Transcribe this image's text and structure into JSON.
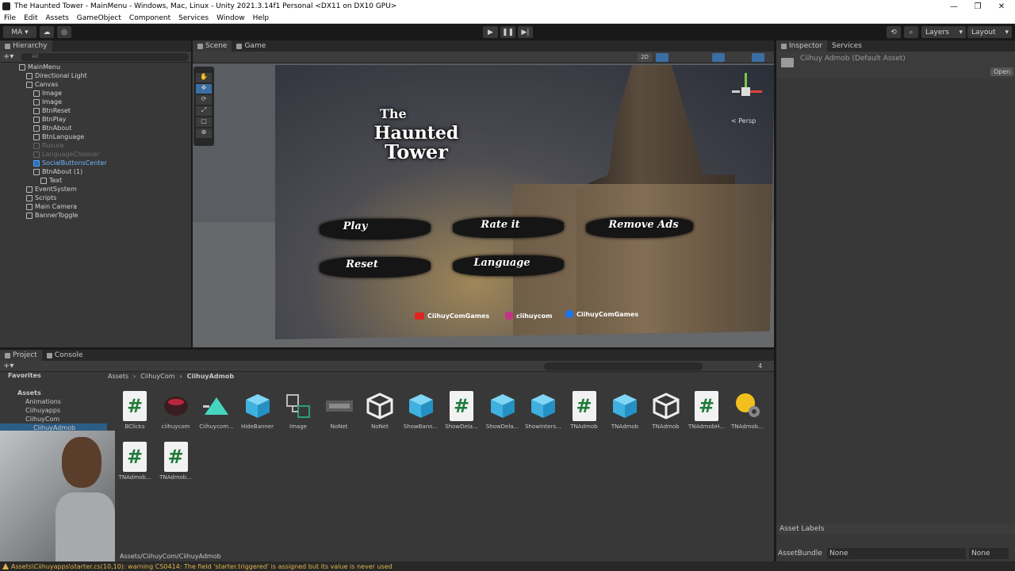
{
  "titlebar": {
    "title": "The Haunted Tower - MainMenu - Windows, Mac, Linux - Unity 2021.3.14f1 Personal <DX11 on DX10 GPU>",
    "minimize": "—",
    "maximize": "❐",
    "close": "✕"
  },
  "menubar": [
    "File",
    "Edit",
    "Assets",
    "GameObject",
    "Component",
    "Services",
    "Window",
    "Help"
  ],
  "toolbar": {
    "account": "MA ▾",
    "layers": "Layers",
    "layout": "Layout"
  },
  "hierarchy": {
    "tab": "Hierarchy",
    "search_placeholder": "All",
    "rows": [
      {
        "label": "MainMenu",
        "state": "normal",
        "indent": 0
      },
      {
        "label": "Directional Light",
        "state": "normal",
        "indent": 1
      },
      {
        "label": "Canvas",
        "state": "normal",
        "indent": 1
      },
      {
        "label": "Image",
        "state": "normal",
        "indent": 2
      },
      {
        "label": "Image",
        "state": "normal",
        "indent": 2
      },
      {
        "label": "BtnReset",
        "state": "normal",
        "indent": 2
      },
      {
        "label": "BtnPlay",
        "state": "normal",
        "indent": 2
      },
      {
        "label": "BtnAbout",
        "state": "normal",
        "indent": 2
      },
      {
        "label": "BtnLanguage",
        "state": "normal",
        "indent": 2
      },
      {
        "label": "Rusure",
        "state": "dim",
        "indent": 2
      },
      {
        "label": "LanguageChooser",
        "state": "dim",
        "indent": 2
      },
      {
        "label": "SocialButtonsCenter",
        "state": "sel",
        "indent": 2
      },
      {
        "label": "BtnAbout (1)",
        "state": "normal",
        "indent": 2
      },
      {
        "label": "Text",
        "state": "normal",
        "indent": 3
      },
      {
        "label": "EventSystem",
        "state": "normal",
        "indent": 1
      },
      {
        "label": "Scripts",
        "state": "normal",
        "indent": 1
      },
      {
        "label": "Main Camera",
        "state": "normal",
        "indent": 1
      },
      {
        "label": "BannerToggle",
        "state": "normal",
        "indent": 1
      }
    ]
  },
  "scene": {
    "tabs": [
      "Scene",
      "Game"
    ],
    "mode_2d": "2D",
    "persp": "< Persp",
    "game": {
      "title_line1": "The",
      "title_line2": "Haunted",
      "title_line3": "Tower",
      "buttons": [
        "Play",
        "Rate it",
        "Remove Ads",
        "Reset",
        "Language"
      ],
      "social": [
        "CiihuyComGames",
        "ciihuycom",
        "CiihuyComGames"
      ]
    }
  },
  "inspector": {
    "tabs": [
      "Inspector",
      "Services"
    ],
    "asset_title": "Ciihuy Admob (Default Asset)",
    "open_button": "Open",
    "asset_labels": "Asset Labels",
    "asset_bundle": "AssetBundle",
    "bundle_value": "None",
    "variant_value": "None"
  },
  "project": {
    "tabs": [
      "Project",
      "Console"
    ],
    "tree": [
      "Favorites",
      "Assets",
      "Animations",
      "Ciihuyapps",
      "CiihuyCom",
      "CiihuyAdmob"
    ],
    "breadcrumb": [
      "Assets",
      "CiihuyCom",
      "CiihuyAdmob"
    ],
    "assets": [
      {
        "name": "BClicks",
        "icon": "script"
      },
      {
        "name": "ciihuycom",
        "icon": "image-red"
      },
      {
        "name": "Ciihuycom...",
        "icon": "anim"
      },
      {
        "name": "HideBanner",
        "icon": "cube"
      },
      {
        "name": "Image",
        "icon": "prefab-link"
      },
      {
        "name": "NoNet",
        "icon": "image-dark"
      },
      {
        "name": "NoNet",
        "icon": "unity"
      },
      {
        "name": "ShowBann...",
        "icon": "cube"
      },
      {
        "name": "ShowDela...",
        "icon": "script"
      },
      {
        "name": "ShowDela...",
        "icon": "cube"
      },
      {
        "name": "ShowInters...",
        "icon": "cube"
      },
      {
        "name": "TNAdmob",
        "icon": "script"
      },
      {
        "name": "TNAdmob",
        "icon": "cube"
      },
      {
        "name": "TNAdmob",
        "icon": "unity"
      },
      {
        "name": "TNAdmobH...",
        "icon": "script"
      },
      {
        "name": "TNAdmob...",
        "icon": "settings"
      },
      {
        "name": "TNAdmob...",
        "icon": "script"
      },
      {
        "name": "TNAdmob...",
        "icon": "script"
      }
    ],
    "path": "Assets/CiihuyCom/CiihuyAdmob",
    "hidden_count": "4"
  },
  "status": {
    "message": "Assets\\Ciihuyapps\\starter.cs(10,10): warning CS0414: The field 'starter.triggered' is assigned but its value is never used"
  },
  "colors": {
    "panel": "#383838",
    "selection": "#4da3ff",
    "warning": "#e0b44a",
    "script_green": "#1f7a3a"
  }
}
